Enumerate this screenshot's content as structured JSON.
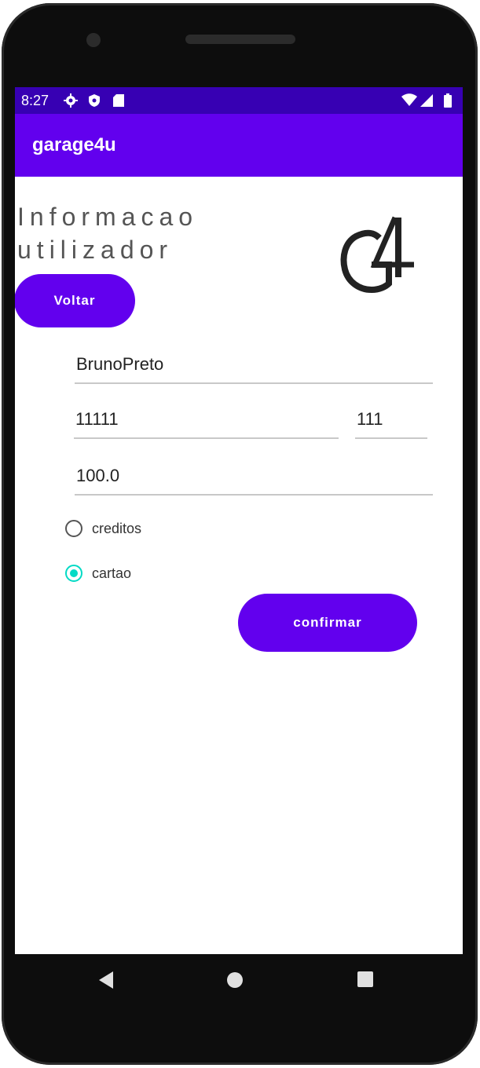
{
  "status_bar": {
    "time": "8:27",
    "left_icons": [
      "settings-icon",
      "shield-icon",
      "sd-card-icon"
    ],
    "right_icons": [
      "wifi-icon",
      "signal-icon",
      "battery-icon"
    ]
  },
  "app_bar": {
    "title": "garage4u"
  },
  "header": {
    "line1": "Informacao",
    "line2": "utilizador",
    "logo_text": "G4"
  },
  "buttons": {
    "back_label": "Voltar",
    "confirm_label": "confirmar"
  },
  "form": {
    "name_value": "BrunoPreto",
    "card_number_value": "11111",
    "cvv_value": "111",
    "amount_value": "100.0"
  },
  "payment_options": [
    {
      "label": "creditos",
      "selected": false
    },
    {
      "label": "cartao",
      "selected": true
    }
  ],
  "colors": {
    "primary": "#6200ee",
    "primary_dark": "#3700b3",
    "accent": "#03dac5"
  },
  "nav_bar": {
    "icons": [
      "back-icon",
      "home-icon",
      "recents-icon"
    ]
  }
}
